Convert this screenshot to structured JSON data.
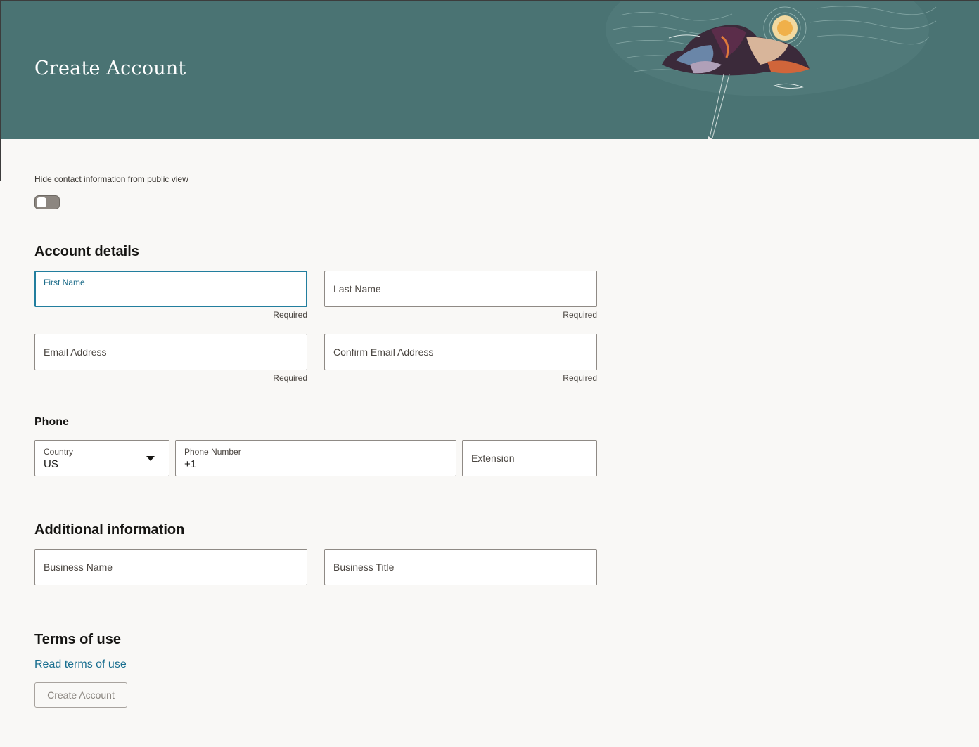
{
  "header": {
    "title": "Create Account"
  },
  "privacy": {
    "toggle_label": "Hide contact information from public view",
    "hide_contact": false
  },
  "account_details": {
    "title": "Account details",
    "first_name": {
      "label": "First Name",
      "value": "",
      "hint": "Required"
    },
    "last_name": {
      "placeholder": "Last Name",
      "hint": "Required"
    },
    "email": {
      "placeholder": "Email Address",
      "hint": "Required"
    },
    "confirm_email": {
      "placeholder": "Confirm Email Address",
      "hint": "Required"
    }
  },
  "phone": {
    "title": "Phone",
    "country": {
      "label": "Country",
      "value": "US"
    },
    "number": {
      "label": "Phone Number",
      "value": "+1"
    },
    "extension": {
      "placeholder": "Extension"
    }
  },
  "additional": {
    "title": "Additional information",
    "business_name": {
      "placeholder": "Business Name"
    },
    "business_title": {
      "placeholder": "Business Title"
    }
  },
  "terms": {
    "title": "Terms of use",
    "link": "Read terms of use",
    "submit": "Create Account"
  },
  "colors": {
    "header_bg": "#4a7373",
    "accent": "#227e9e",
    "link": "#1a6f90"
  }
}
